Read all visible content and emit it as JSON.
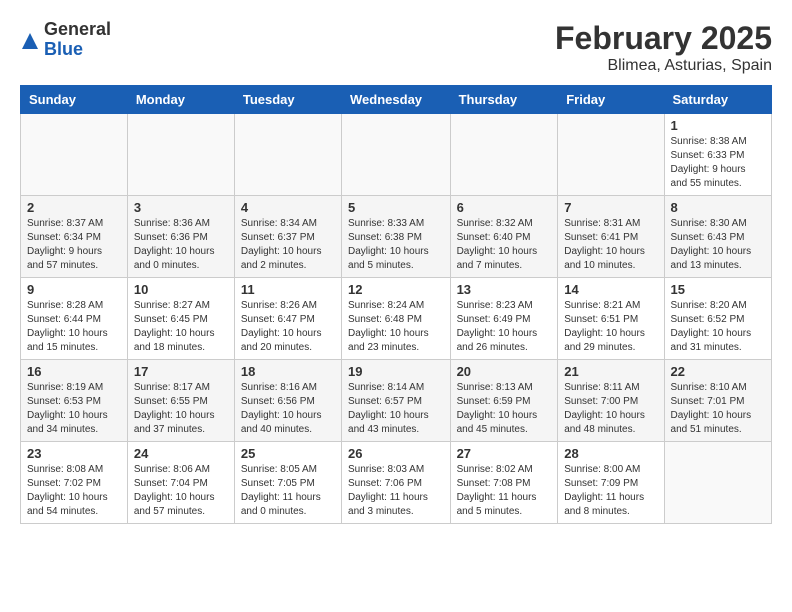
{
  "header": {
    "logo_general": "General",
    "logo_blue": "Blue",
    "title": "February 2025",
    "subtitle": "Blimea, Asturias, Spain"
  },
  "days_of_week": [
    "Sunday",
    "Monday",
    "Tuesday",
    "Wednesday",
    "Thursday",
    "Friday",
    "Saturday"
  ],
  "weeks": [
    {
      "days": [
        {
          "num": "",
          "info": ""
        },
        {
          "num": "",
          "info": ""
        },
        {
          "num": "",
          "info": ""
        },
        {
          "num": "",
          "info": ""
        },
        {
          "num": "",
          "info": ""
        },
        {
          "num": "",
          "info": ""
        },
        {
          "num": "1",
          "info": "Sunrise: 8:38 AM\nSunset: 6:33 PM\nDaylight: 9 hours and 55 minutes."
        }
      ]
    },
    {
      "days": [
        {
          "num": "2",
          "info": "Sunrise: 8:37 AM\nSunset: 6:34 PM\nDaylight: 9 hours and 57 minutes."
        },
        {
          "num": "3",
          "info": "Sunrise: 8:36 AM\nSunset: 6:36 PM\nDaylight: 10 hours and 0 minutes."
        },
        {
          "num": "4",
          "info": "Sunrise: 8:34 AM\nSunset: 6:37 PM\nDaylight: 10 hours and 2 minutes."
        },
        {
          "num": "5",
          "info": "Sunrise: 8:33 AM\nSunset: 6:38 PM\nDaylight: 10 hours and 5 minutes."
        },
        {
          "num": "6",
          "info": "Sunrise: 8:32 AM\nSunset: 6:40 PM\nDaylight: 10 hours and 7 minutes."
        },
        {
          "num": "7",
          "info": "Sunrise: 8:31 AM\nSunset: 6:41 PM\nDaylight: 10 hours and 10 minutes."
        },
        {
          "num": "8",
          "info": "Sunrise: 8:30 AM\nSunset: 6:43 PM\nDaylight: 10 hours and 13 minutes."
        }
      ]
    },
    {
      "days": [
        {
          "num": "9",
          "info": "Sunrise: 8:28 AM\nSunset: 6:44 PM\nDaylight: 10 hours and 15 minutes."
        },
        {
          "num": "10",
          "info": "Sunrise: 8:27 AM\nSunset: 6:45 PM\nDaylight: 10 hours and 18 minutes."
        },
        {
          "num": "11",
          "info": "Sunrise: 8:26 AM\nSunset: 6:47 PM\nDaylight: 10 hours and 20 minutes."
        },
        {
          "num": "12",
          "info": "Sunrise: 8:24 AM\nSunset: 6:48 PM\nDaylight: 10 hours and 23 minutes."
        },
        {
          "num": "13",
          "info": "Sunrise: 8:23 AM\nSunset: 6:49 PM\nDaylight: 10 hours and 26 minutes."
        },
        {
          "num": "14",
          "info": "Sunrise: 8:21 AM\nSunset: 6:51 PM\nDaylight: 10 hours and 29 minutes."
        },
        {
          "num": "15",
          "info": "Sunrise: 8:20 AM\nSunset: 6:52 PM\nDaylight: 10 hours and 31 minutes."
        }
      ]
    },
    {
      "days": [
        {
          "num": "16",
          "info": "Sunrise: 8:19 AM\nSunset: 6:53 PM\nDaylight: 10 hours and 34 minutes."
        },
        {
          "num": "17",
          "info": "Sunrise: 8:17 AM\nSunset: 6:55 PM\nDaylight: 10 hours and 37 minutes."
        },
        {
          "num": "18",
          "info": "Sunrise: 8:16 AM\nSunset: 6:56 PM\nDaylight: 10 hours and 40 minutes."
        },
        {
          "num": "19",
          "info": "Sunrise: 8:14 AM\nSunset: 6:57 PM\nDaylight: 10 hours and 43 minutes."
        },
        {
          "num": "20",
          "info": "Sunrise: 8:13 AM\nSunset: 6:59 PM\nDaylight: 10 hours and 45 minutes."
        },
        {
          "num": "21",
          "info": "Sunrise: 8:11 AM\nSunset: 7:00 PM\nDaylight: 10 hours and 48 minutes."
        },
        {
          "num": "22",
          "info": "Sunrise: 8:10 AM\nSunset: 7:01 PM\nDaylight: 10 hours and 51 minutes."
        }
      ]
    },
    {
      "days": [
        {
          "num": "23",
          "info": "Sunrise: 8:08 AM\nSunset: 7:02 PM\nDaylight: 10 hours and 54 minutes."
        },
        {
          "num": "24",
          "info": "Sunrise: 8:06 AM\nSunset: 7:04 PM\nDaylight: 10 hours and 57 minutes."
        },
        {
          "num": "25",
          "info": "Sunrise: 8:05 AM\nSunset: 7:05 PM\nDaylight: 11 hours and 0 minutes."
        },
        {
          "num": "26",
          "info": "Sunrise: 8:03 AM\nSunset: 7:06 PM\nDaylight: 11 hours and 3 minutes."
        },
        {
          "num": "27",
          "info": "Sunrise: 8:02 AM\nSunset: 7:08 PM\nDaylight: 11 hours and 5 minutes."
        },
        {
          "num": "28",
          "info": "Sunrise: 8:00 AM\nSunset: 7:09 PM\nDaylight: 11 hours and 8 minutes."
        },
        {
          "num": "",
          "info": ""
        }
      ]
    }
  ]
}
